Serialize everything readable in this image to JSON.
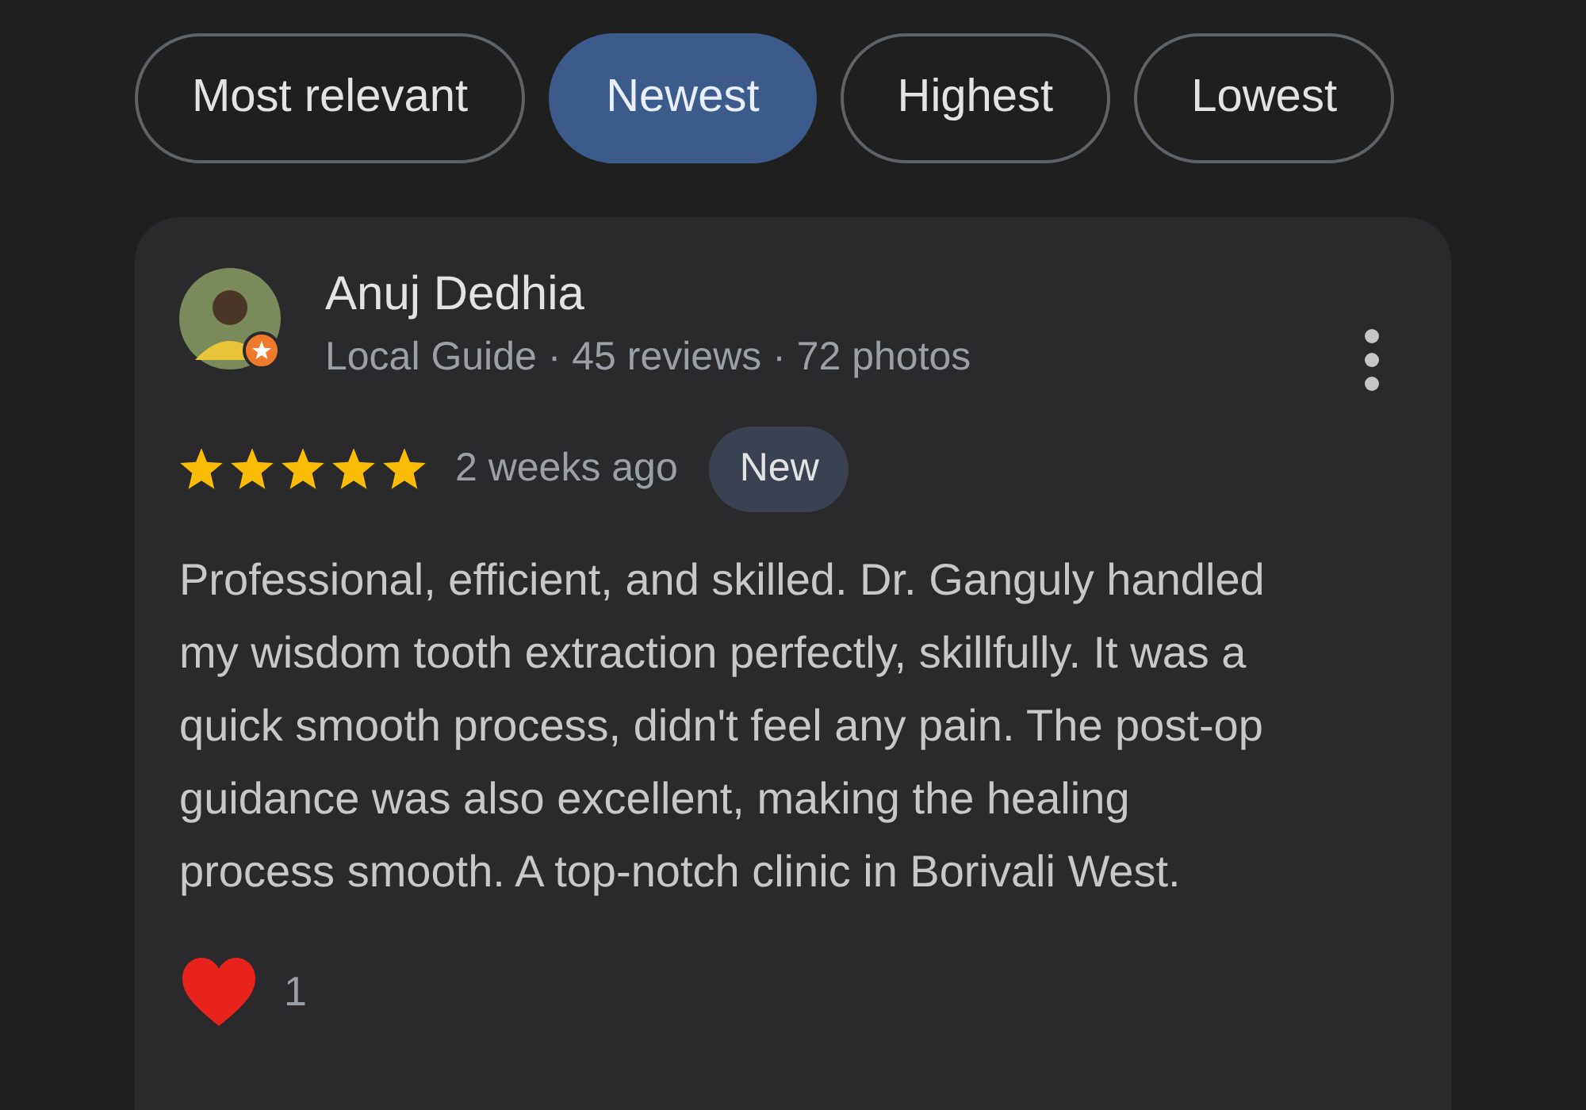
{
  "filters": [
    {
      "label": "Most relevant",
      "selected": false
    },
    {
      "label": "Newest",
      "selected": true
    },
    {
      "label": "Highest",
      "selected": false
    },
    {
      "label": "Lowest",
      "selected": false
    }
  ],
  "review": {
    "author": "Anuj Dedhia",
    "author_details": "Local Guide · 45 reviews · 72 photos",
    "stars": 5,
    "time": "2 weeks ago",
    "badge": "New",
    "text": "Professional, efficient, and skilled. Dr. Ganguly handled my wisdom tooth extraction perfectly, skillfully. It was a quick smooth process, didn't feel any pain. The post-op guidance was also excellent, making the healing process smooth. A top-notch clinic in Borivali West.",
    "reaction_count": "1"
  }
}
